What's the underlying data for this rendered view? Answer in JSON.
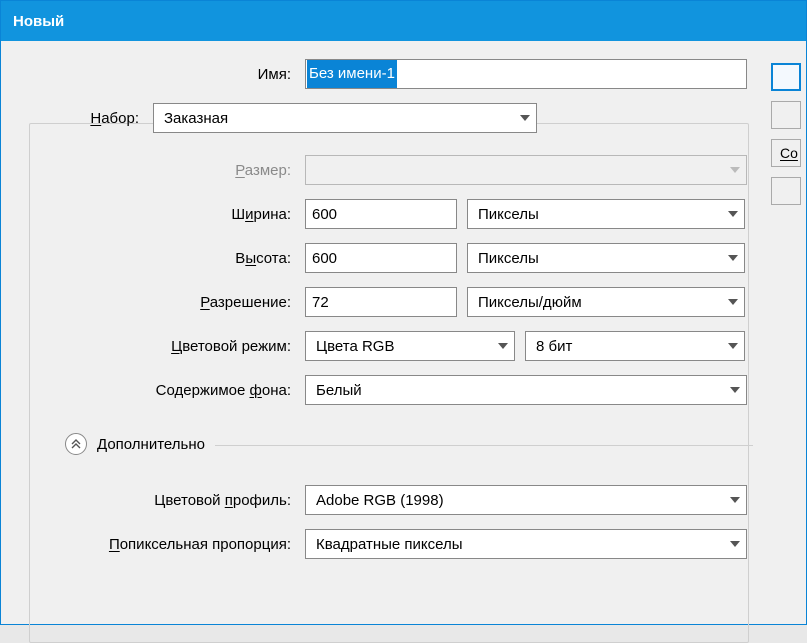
{
  "title": "Новый",
  "labels": {
    "name": "Имя:",
    "preset": "Набор:",
    "preset_u": "Н",
    "size": "Размер:",
    "size_u": "Р",
    "width": "Ширина:",
    "width_u": "и",
    "height": "Высота:",
    "height_u": "ы",
    "resolution": "Разрешение:",
    "resolution_u": "Р",
    "colormode": "Цветовой режим:",
    "colormode_u": "Ц",
    "bgcontents": "Содержимое фона:",
    "bgcontents_u": "ф",
    "advanced": "Дополнительно",
    "profile": "Цветовой профиль:",
    "profile_u": "п",
    "pixelaspect": "Попиксельная пропорция:",
    "pixelaspect_u": "П"
  },
  "values": {
    "name": "Без имени-1",
    "preset": "Заказная",
    "size": "",
    "width": "600",
    "width_unit": "Пикселы",
    "height": "600",
    "height_unit": "Пикселы",
    "resolution": "72",
    "resolution_unit": "Пикселы/дюйм",
    "colormode": "Цвета RGB",
    "bitdepth": "8 бит",
    "bgcontents": "Белый",
    "profile": "Adobe RGB (1998)",
    "pixelaspect": "Квадратные пикселы"
  },
  "side": {
    "save_preset": "Со"
  }
}
